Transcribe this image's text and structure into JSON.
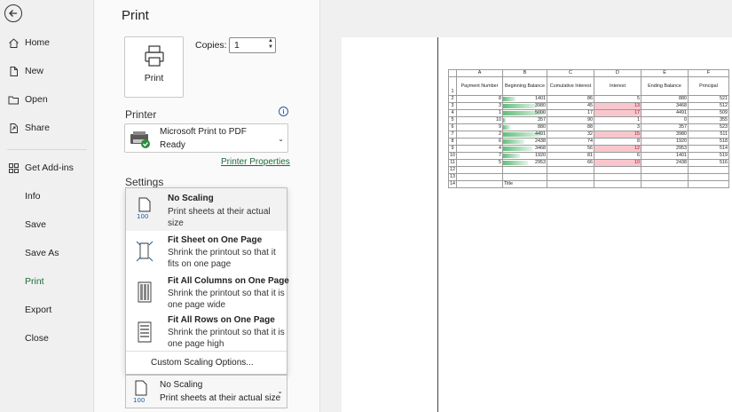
{
  "sidebar": {
    "items": [
      {
        "label": "Home",
        "icon": "home-icon"
      },
      {
        "label": "New",
        "icon": "new-file-icon"
      },
      {
        "label": "Open",
        "icon": "folder-icon"
      },
      {
        "label": "Share",
        "icon": "share-icon"
      },
      {
        "label": "Get Add-ins",
        "icon": "add-ins-icon"
      },
      {
        "label": "Info"
      },
      {
        "label": "Save"
      },
      {
        "label": "Save As"
      },
      {
        "label": "Print"
      },
      {
        "label": "Export"
      },
      {
        "label": "Close"
      }
    ],
    "active": "Print"
  },
  "page_title": "Print",
  "print_button_label": "Print",
  "copies": {
    "label": "Copies:",
    "value": "1"
  },
  "printer": {
    "section_title": "Printer",
    "name": "Microsoft Print to PDF",
    "status": "Ready",
    "properties_link": "Printer Properties"
  },
  "settings": {
    "section_title": "Settings",
    "scaling_options": [
      {
        "title": "No Scaling",
        "description": "Print sheets at their actual size",
        "icon": "no-scaling-icon"
      },
      {
        "title": "Fit Sheet on One Page",
        "description": "Shrink the printout so that it fits on one page",
        "icon": "fit-sheet-icon"
      },
      {
        "title": "Fit All Columns on One Page",
        "description": "Shrink the printout so that it is one page wide",
        "icon": "fit-columns-icon"
      },
      {
        "title": "Fit All Rows on One Page",
        "description": "Shrink the printout so that it is one page high",
        "icon": "fit-rows-icon"
      }
    ],
    "custom_scaling": "Custom Scaling Options...",
    "current": {
      "title": "No Scaling",
      "description": "Print sheets at their actual size",
      "icon_text": "100"
    }
  },
  "preview": {
    "column_letters": [
      "A",
      "B",
      "C",
      "D",
      "E",
      "F"
    ],
    "headers": [
      "Payment Number",
      "Beginning Balance",
      "Cumulative Interest",
      "Interest",
      "Ending Balance",
      "Principal"
    ],
    "rows": [
      {
        "row": "2",
        "payment": "8",
        "beginning": "1401",
        "beginning_pct": 0.28,
        "cumulative": "86",
        "interest": "5",
        "interest_high": false,
        "ending": "880",
        "principal": "521"
      },
      {
        "row": "3",
        "payment": "3",
        "beginning": "3980",
        "beginning_pct": 0.78,
        "cumulative": "45",
        "interest": "13",
        "interest_high": true,
        "ending": "3468",
        "principal": "512"
      },
      {
        "row": "4",
        "payment": "1",
        "beginning": "5000",
        "beginning_pct": 0.98,
        "cumulative": "17",
        "interest": "17",
        "interest_high": true,
        "ending": "4491",
        "principal": "509"
      },
      {
        "row": "5",
        "payment": "10",
        "beginning": "357",
        "beginning_pct": 0.07,
        "cumulative": "90",
        "interest": "1",
        "interest_high": false,
        "ending": "0",
        "principal": "355"
      },
      {
        "row": "6",
        "payment": "9",
        "beginning": "880",
        "beginning_pct": 0.17,
        "cumulative": "88",
        "interest": "3",
        "interest_high": false,
        "ending": "357",
        "principal": "523"
      },
      {
        "row": "7",
        "payment": "2",
        "beginning": "4491",
        "beginning_pct": 0.88,
        "cumulative": "32",
        "interest": "15",
        "interest_high": true,
        "ending": "3980",
        "principal": "511"
      },
      {
        "row": "8",
        "payment": "6",
        "beginning": "2438",
        "beginning_pct": 0.48,
        "cumulative": "74",
        "interest": "8",
        "interest_high": false,
        "ending": "1920",
        "principal": "518"
      },
      {
        "row": "9",
        "payment": "4",
        "beginning": "3468",
        "beginning_pct": 0.68,
        "cumulative": "56",
        "interest": "12",
        "interest_high": true,
        "ending": "2953",
        "principal": "514"
      },
      {
        "row": "10",
        "payment": "7",
        "beginning": "1920",
        "beginning_pct": 0.38,
        "cumulative": "81",
        "interest": "6",
        "interest_high": false,
        "ending": "1401",
        "principal": "519"
      },
      {
        "row": "11",
        "payment": "5",
        "beginning": "2953",
        "beginning_pct": 0.58,
        "cumulative": "66",
        "interest": "10",
        "interest_high": true,
        "ending": "2438",
        "principal": "516"
      }
    ],
    "empty_rows": [
      "12",
      "13"
    ],
    "last_row": {
      "row": "14",
      "b_text": "Title"
    }
  }
}
